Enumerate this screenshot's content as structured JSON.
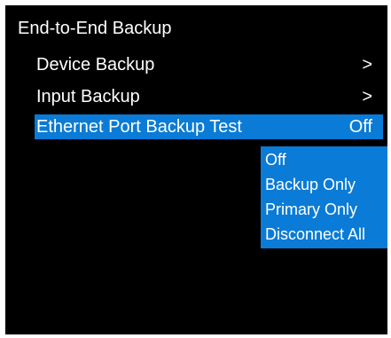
{
  "screen": {
    "title": "End-to-End Backup"
  },
  "menu": {
    "items": [
      {
        "label": "Device Backup",
        "chevron": ">"
      },
      {
        "label": "Input Backup",
        "chevron": ">"
      },
      {
        "label": "Ethernet Port Backup Test",
        "value": "Off"
      }
    ]
  },
  "dropdown": {
    "options": [
      "Off",
      "Backup Only",
      "Primary Only",
      "Disconnect All"
    ]
  },
  "colors": {
    "background": "#000000",
    "accent": "#0a7bd6",
    "text": "#ffffff"
  }
}
